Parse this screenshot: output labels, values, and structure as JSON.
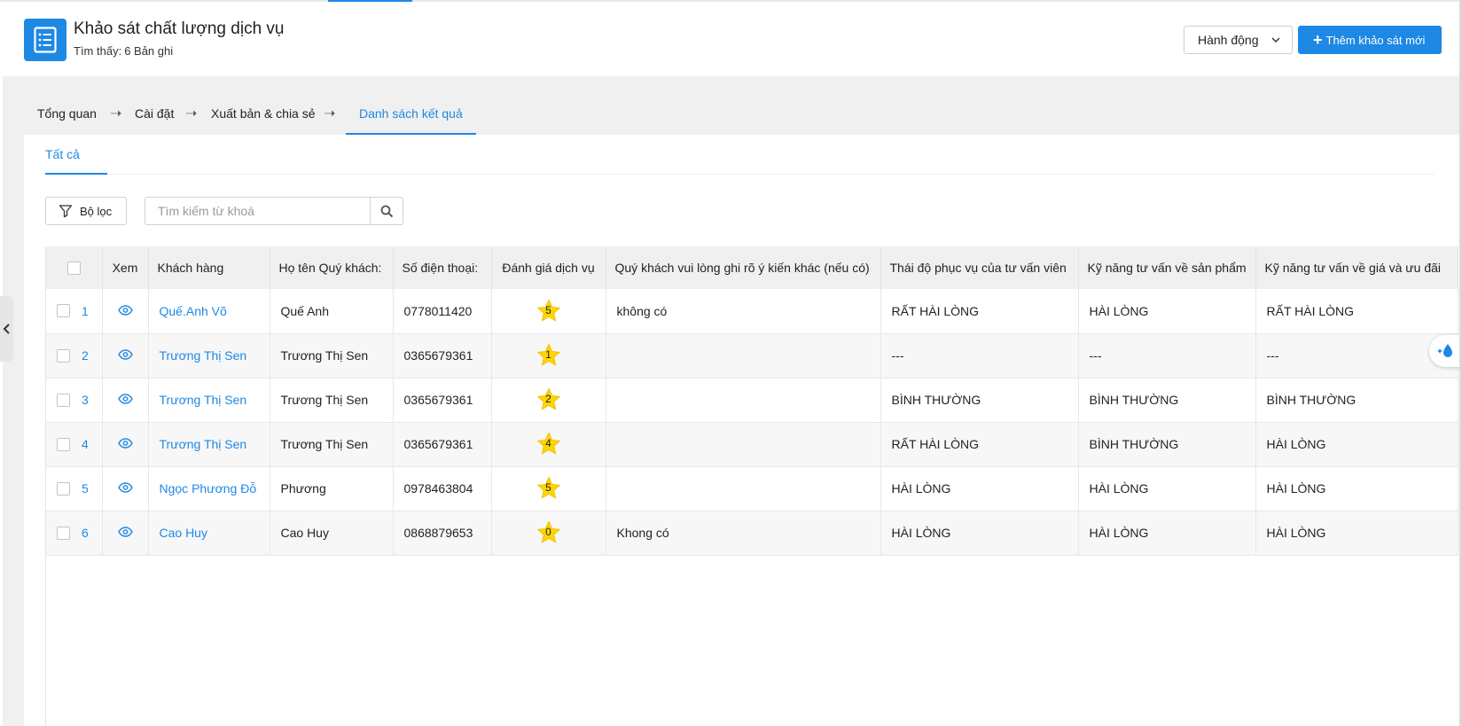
{
  "header": {
    "title": "Khảo sát chất lượng dịch vụ",
    "subtitle_prefix": "Tìm thấy:",
    "subtitle_count": "6 Bản ghi",
    "action_label": "Hành động",
    "new_label": "Thêm khảo sát mới"
  },
  "steps": [
    "Tổng quan",
    "Cài đặt",
    "Xuất bản & chia sẻ",
    "Danh sách kết quả"
  ],
  "subtab": "Tất cả",
  "filter_label": "Bộ lọc",
  "search": {
    "placeholder": "Tìm kiếm từ khoá"
  },
  "table": {
    "headers": [
      "Xem",
      "Khách hàng",
      "Họ tên Quý khách:",
      "Số điện thoại:",
      "Đánh giá dịch vụ",
      "Quý khách vui lòng ghi rõ ý kiến khác (nếu có)",
      "Thái độ phục vụ của tư vấn viên",
      "Kỹ năng tư vấn về sản phẩm",
      "Kỹ năng tư vấn về giá và ưu đãi"
    ],
    "rows": [
      {
        "idx": "1",
        "customer": "Quế.Anh Võ",
        "name": "Quế Anh",
        "phone": "0778011420",
        "rating": "5",
        "comment": "không có",
        "attitude": "RẤT HÀI LÒNG",
        "product": "HÀI LÒNG",
        "price": "RẤT HÀI LÒNG"
      },
      {
        "idx": "2",
        "customer": "Trương Thị Sen",
        "name": "Trương Thị Sen",
        "phone": "0365679361",
        "rating": "1",
        "comment": "",
        "attitude": "---",
        "product": "---",
        "price": "---"
      },
      {
        "idx": "3",
        "customer": "Trương Thị Sen",
        "name": "Trương Thị Sen",
        "phone": "0365679361",
        "rating": "2",
        "comment": "",
        "attitude": "BÌNH THƯỜNG",
        "product": "BÌNH THƯỜNG",
        "price": "BÌNH THƯỜNG"
      },
      {
        "idx": "4",
        "customer": "Trương Thị Sen",
        "name": "Trương Thị Sen",
        "phone": "0365679361",
        "rating": "4",
        "comment": "",
        "attitude": "RẤT HÀI LÒNG",
        "product": "BÌNH THƯỜNG",
        "price": "HÀI LÒNG"
      },
      {
        "idx": "5",
        "customer": "Ngọc Phương Đỗ",
        "name": "Phương",
        "phone": "0978463804",
        "rating": "5",
        "comment": "",
        "attitude": "HÀI LÒNG",
        "product": "HÀI LÒNG",
        "price": "HÀI LÒNG"
      },
      {
        "idx": "6",
        "customer": "Cao Huy",
        "name": "Cao Huy",
        "phone": "0868879653",
        "rating": "0",
        "comment": "Khong có",
        "attitude": "HÀI LÒNG",
        "product": "HÀI LÒNG",
        "price": "HÀI LÒNG"
      }
    ]
  },
  "colors": {
    "accent": "#1e88e5",
    "star": "#ffd600"
  },
  "icons": [
    "list-doc-icon",
    "chevron-down-icon",
    "plus-icon",
    "arrow-right-icon",
    "filter-icon",
    "search-icon",
    "eye-icon",
    "star-icon",
    "chevron-left-icon",
    "sparkle-drop-icon"
  ]
}
